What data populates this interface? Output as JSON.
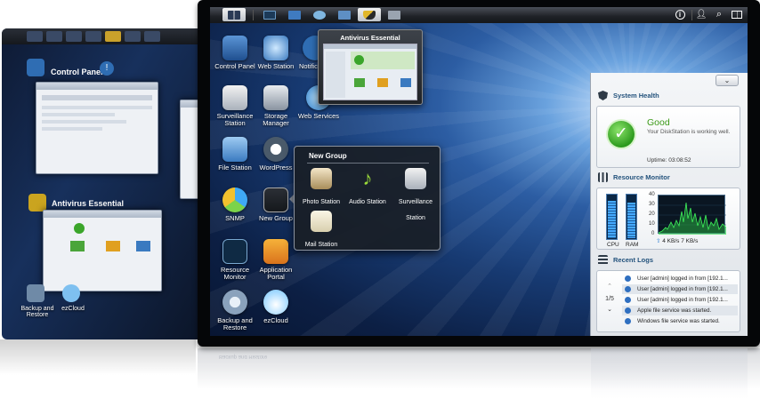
{
  "back_screen": {
    "window_titles": [
      "Control Panel",
      "Antivirus Essential"
    ],
    "icons": [
      "Backup and Restore",
      "ezCloud"
    ]
  },
  "taskbar": {
    "apps": [
      {
        "icon": "main-menu-icon",
        "active": true
      },
      {
        "icon": "resource-monitor-icon",
        "active": false
      },
      {
        "icon": "control-panel-icon",
        "active": false
      },
      {
        "icon": "web-station-icon",
        "active": false
      },
      {
        "icon": "storage-manager-icon",
        "active": false
      },
      {
        "icon": "antivirus-icon",
        "active": true
      },
      {
        "icon": "eraser-icon",
        "active": false
      }
    ],
    "right": [
      "info-icon",
      "user-icon",
      "search-icon",
      "widget-icon"
    ]
  },
  "desktop": {
    "icons": [
      {
        "label": "Control Panel",
        "icon": "control-panel-icon"
      },
      {
        "label": "Web Station",
        "icon": "web-station-icon"
      },
      {
        "label": "Notific",
        "icon": "notification-icon"
      },
      {
        "label": "Surveillance Station",
        "icon": "surveillance-icon"
      },
      {
        "label": "Storage Manager",
        "icon": "storage-manager-icon"
      },
      {
        "label": "Web Services",
        "icon": "web-services-icon"
      },
      {
        "label": "File Station",
        "icon": "file-station-icon"
      },
      {
        "label": "WordPress",
        "icon": "wordpress-icon"
      },
      {
        "label": "SNMP",
        "icon": "snmp-icon"
      },
      {
        "label": "New Group",
        "icon": "group-icon"
      },
      {
        "label": "Resource Monitor",
        "icon": "resource-monitor-icon"
      },
      {
        "label": "Application Portal",
        "icon": "application-portal-icon"
      },
      {
        "label": "Backup and Restore",
        "icon": "backup-icon"
      },
      {
        "label": "ezCloud",
        "icon": "ezcloud-icon"
      }
    ]
  },
  "antivirus_popup": {
    "title": "Antivirus Essential"
  },
  "group_popup": {
    "title": "New Group",
    "items": [
      {
        "label": "Photo Station",
        "icon": "photo-station-icon"
      },
      {
        "label": "Audio Station",
        "icon": "audio-station-icon"
      },
      {
        "label": "Surveillance Station",
        "icon": "surveillance-icon"
      },
      {
        "label": "Mail Station",
        "icon": "mail-station-icon"
      }
    ]
  },
  "widgets": {
    "toggle": "⌄",
    "system_health": {
      "title": "System Health",
      "status": "Good",
      "description": "Your DiskStation is working well.",
      "uptime": "Uptime: 03:08:52"
    },
    "resource_monitor": {
      "title": "Resource Monitor",
      "cpu_label": "CPU",
      "ram_label": "RAM",
      "cpu_percent": 85,
      "ram_percent": 80,
      "ticks": [
        "40",
        "30",
        "20",
        "10",
        "0"
      ],
      "speed": "4 KB/s  7 KB/s"
    },
    "recent_logs": {
      "title": "Recent Logs",
      "page": "1/5",
      "entries": [
        "User [admin] logged in from [192.1...",
        "User [admin] logged in from [192.1...",
        "User [admin] logged in from [192.1...",
        "Apple file service was started.",
        "Windows file service was started."
      ]
    }
  },
  "colors": {
    "accent": "#23527c",
    "good": "#3c9a18",
    "desktop": "#173a72"
  }
}
